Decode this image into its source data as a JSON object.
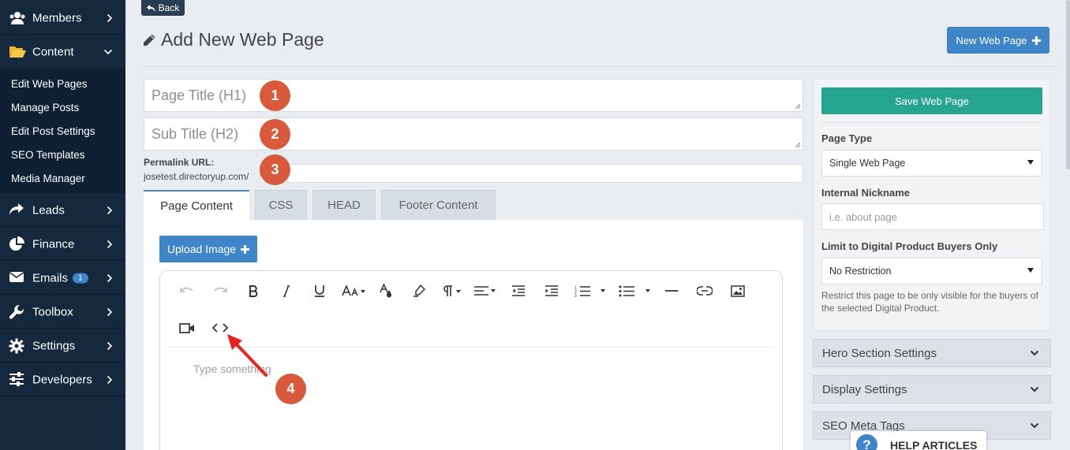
{
  "sidebar": {
    "items": [
      {
        "label": "Members",
        "icon": "users-icon"
      },
      {
        "label": "Content",
        "icon": "folder-open-icon"
      },
      {
        "label": "Leads",
        "icon": "share-arrow-icon"
      },
      {
        "label": "Finance",
        "icon": "pie-chart-icon"
      },
      {
        "label": "Emails",
        "icon": "envelope-icon",
        "badge": "1"
      },
      {
        "label": "Toolbox",
        "icon": "wrench-icon"
      },
      {
        "label": "Settings",
        "icon": "gear-icon"
      },
      {
        "label": "Developers",
        "icon": "sliders-icon"
      }
    ],
    "content_submenu": [
      "Edit Web Pages",
      "Manage Posts",
      "Edit Post Settings",
      "SEO Templates",
      "Media Manager"
    ]
  },
  "header": {
    "back_label": "Back",
    "title": "Add New Web Page",
    "new_page_label": "New Web Page"
  },
  "form": {
    "title_placeholder": "Page Title (H1)",
    "subtitle_placeholder": "Sub Title (H2)",
    "permalink_label": "Permalink URL:",
    "permalink_prefix": "josetest.directoryup.com/",
    "permalink_value": ""
  },
  "tabs": [
    "Page Content",
    "CSS",
    "HEAD",
    "Footer Content"
  ],
  "editor": {
    "upload_label": "Upload Image",
    "placeholder": "Type something",
    "toolbar": [
      "undo",
      "redo",
      "bold",
      "italic",
      "underline",
      "font-size",
      "text-color",
      "highlight",
      "paragraph",
      "align",
      "outdent",
      "indent",
      "ordered-list",
      "unordered-list",
      "horizontal-rule",
      "link",
      "image",
      "video",
      "code-view"
    ]
  },
  "callouts": [
    "1",
    "2",
    "3",
    "4"
  ],
  "right_panel": {
    "save_label": "Save Web Page",
    "page_type_label": "Page Type",
    "page_type_value": "Single Web Page",
    "nickname_label": "Internal Nickname",
    "nickname_placeholder": "i.e. about page",
    "restrict_label": "Limit to Digital Product Buyers Only",
    "restrict_value": "No Restriction",
    "restrict_help": "Restrict this page to be only visible for the buyers of the selected Digital Product."
  },
  "accordions": [
    "Hero Section Settings",
    "Display Settings",
    "SEO Meta Tags"
  ],
  "help": {
    "label": "HELP ARTICLES",
    "icon_text": "?"
  },
  "colors": {
    "sidebar_bg": "#15283d",
    "primary": "#3e86c8",
    "save": "#26a591",
    "callout": "#d9593d"
  }
}
